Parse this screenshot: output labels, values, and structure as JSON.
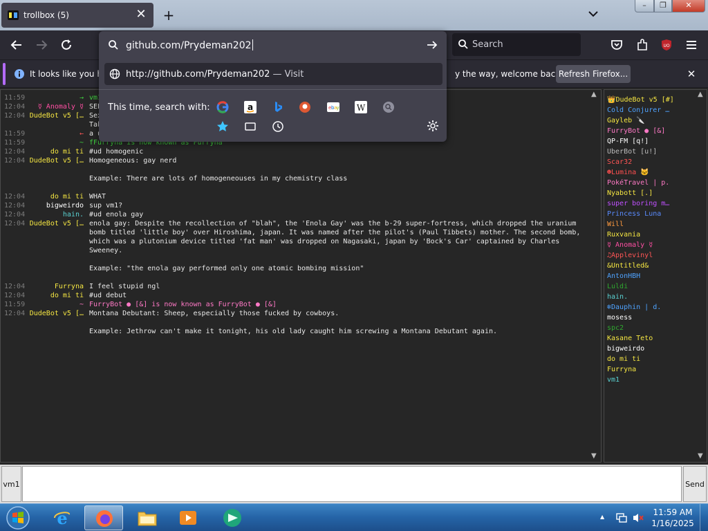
{
  "window": {
    "tab_title": "trollbox (5)",
    "close_tab_symbol": "✕",
    "new_tab_symbol": "+"
  },
  "url_bar": {
    "typed": "github.com/Prydeman202",
    "suggestion_url": "http://github.com/Prydeman202",
    "suggestion_sep": " — ",
    "suggestion_action": "Visit",
    "search_with_label": "This time, search with:",
    "engines": [
      "google-icon",
      "amazon-icon",
      "bing-icon",
      "duckduckgo-icon",
      "ebay-icon",
      "wikipedia-icon",
      "search-engine-icon",
      "bookmarks-icon",
      "tabs-icon",
      "history-icon"
    ]
  },
  "nav": {
    "search_placeholder": "Search"
  },
  "notification": {
    "text_left": "It looks like you ha",
    "text_right": "y the way, welcome back!",
    "refresh_label": "Refresh Firefox..."
  },
  "chat": {
    "messages": [
      {
        "ts": "11:59",
        "nick": "→",
        "nick_color": "#3fd23f",
        "text": "vm1 has entered teh trollbox",
        "text_color": "#3fd23f"
      },
      {
        "ts": "12:04",
        "nick": "☿ Anomaly ☿",
        "nick_color": "#ff4fa3",
        "text": "SEEEEEEX",
        "text_color": "#e8e8e8"
      },
      {
        "ts": "12:04",
        "nick": "DudeBot v5 […",
        "nick_color": "#f5e642",
        "text": "Sex: [definition]",
        "text_color": "#e8e8e8"
      },
      {
        "ts": "",
        "nick": "",
        "nick_color": "#e8e8e8",
        "text": "Taken from Urban Dictionary",
        "text_color": "#e8e8e8"
      },
      {
        "ts": "11:59",
        "nick": "←",
        "nick_color": "#ff5555",
        "text": "a user left",
        "text_color": "#e8e8e8"
      },
      {
        "ts": "11:59",
        "nick": "~",
        "nick_color": "#3fd23f",
        "text": "fFurryna is now known as Furryna",
        "text_color": "#3fd23f"
      },
      {
        "ts": "12:04",
        "nick": "do mi ti",
        "nick_color": "#f5e642",
        "text": "#ud homogenic",
        "text_color": "#e8e8e8"
      },
      {
        "ts": "12:04",
        "nick": "DudeBot v5 […",
        "nick_color": "#f5e642",
        "text": "Homogeneous: gay nerd",
        "text_color": "#e8e8e8"
      },
      {
        "ts": "",
        "nick": "",
        "nick_color": "#e8e8e8",
        "text": "",
        "text_color": "#e8e8e8"
      },
      {
        "ts": "",
        "nick": "",
        "nick_color": "#e8e8e8",
        "text": "Example: There are lots of homogeneouses in my chemistry class",
        "text_color": "#e8e8e8"
      },
      {
        "ts": "",
        "nick": "",
        "nick_color": "#e8e8e8",
        "text": "",
        "text_color": "#e8e8e8"
      },
      {
        "ts": "12:04",
        "nick": "do mi ti",
        "nick_color": "#f5e642",
        "text": "WHAT",
        "text_color": "#e8e8e8"
      },
      {
        "ts": "12:04",
        "nick": "bigweirdo",
        "nick_color": "#ffffff",
        "text": "sup vm1?",
        "text_color": "#e8e8e8"
      },
      {
        "ts": "12:04",
        "nick": "hain.",
        "nick_color": "#5ad2d2",
        "text": "#ud enola gay",
        "text_color": "#e8e8e8"
      },
      {
        "ts": "12:04",
        "nick": "DudeBot v5 […",
        "nick_color": "#f5e642",
        "text": "enola gay: Despite the recollection of \"blah\", the 'Enola Gay' was the b-29 super-fortress, which dropped the uranium bomb titled 'little boy' over Hiroshima, japan. It was named after the pilot's (Paul Tibbets) mother. The second bomb, which was a plutonium device titled 'fat man' was dropped on Nagasaki, japan by 'Bock's Car' captained by Charles Sweeney.",
        "text_color": "#e8e8e8"
      },
      {
        "ts": "",
        "nick": "",
        "nick_color": "#e8e8e8",
        "text": "",
        "text_color": "#e8e8e8"
      },
      {
        "ts": "",
        "nick": "",
        "nick_color": "#e8e8e8",
        "text": "Example: \"the enola gay performed only one atomic bombing mission\"",
        "text_color": "#e8e8e8"
      },
      {
        "ts": "",
        "nick": "",
        "nick_color": "#e8e8e8",
        "text": "",
        "text_color": "#e8e8e8"
      },
      {
        "ts": "12:04",
        "nick": "Furryna",
        "nick_color": "#f5e642",
        "text": "I feel stupid ngl",
        "text_color": "#e8e8e8"
      },
      {
        "ts": "12:04",
        "nick": "do mi ti",
        "nick_color": "#f5e642",
        "text": "#ud debut",
        "text_color": "#e8e8e8"
      },
      {
        "ts": "11:59",
        "nick": "~",
        "nick_color": "#ff79c6",
        "text": "FurryBot ● [&] is now known as FurryBot ● [&]",
        "text_color": "#ff79c6"
      },
      {
        "ts": "12:04",
        "nick": "DudeBot v5 […",
        "nick_color": "#f5e642",
        "text": "Montana Debutant: Sheep, especially those fucked by cowboys.",
        "text_color": "#e8e8e8"
      },
      {
        "ts": "",
        "nick": "",
        "nick_color": "#e8e8e8",
        "text": "",
        "text_color": "#e8e8e8"
      },
      {
        "ts": "",
        "nick": "",
        "nick_color": "#e8e8e8",
        "text": "Example: Jethrow can't make it tonight, his old lady caught him screwing a Montana Debutant again.",
        "text_color": "#e8e8e8"
      }
    ]
  },
  "users": [
    {
      "name": "👑DudeBot v5 [#]",
      "color": "#f5e642"
    },
    {
      "name": "Cold Conjurer …",
      "color": "#4fa3ff"
    },
    {
      "name": "Gayleb 🔪",
      "color": "#f5e642"
    },
    {
      "name": "FurryBot ● [&]",
      "color": "#ff79c6"
    },
    {
      "name": "QP-FM [q!]",
      "color": "#ffffff"
    },
    {
      "name": "UberBot [u!]",
      "color": "#bbbbbb"
    },
    {
      "name": "Scar32",
      "color": "#ff5555"
    },
    {
      "name": "☻Lumina 🐱",
      "color": "#ff4f4f"
    },
    {
      "name": "PokéTravel | p.",
      "color": "#ff79c6"
    },
    {
      "name": "Nyabott [.]",
      "color": "#f5e642"
    },
    {
      "name": "super boring m…",
      "color": "#c050ff"
    },
    {
      "name": "Princess Luna",
      "color": "#5a8cff"
    },
    {
      "name": "Will",
      "color": "#ff9b3f"
    },
    {
      "name": "Ruxvania",
      "color": "#f5e642"
    },
    {
      "name": "☿ Anomaly ☿",
      "color": "#ff4fa3"
    },
    {
      "name": "♫Applevinyl",
      "color": "#ff5555"
    },
    {
      "name": "&Untitled&",
      "color": "#f5e642"
    },
    {
      "name": "AntonHBH",
      "color": "#4fa3ff"
    },
    {
      "name": "Luldi",
      "color": "#2fa82f"
    },
    {
      "name": "hain.",
      "color": "#5ad2d2"
    },
    {
      "name": "❄Dauphin | d.",
      "color": "#4fa3ff"
    },
    {
      "name": "mosess",
      "color": "#ffffff"
    },
    {
      "name": "spc2",
      "color": "#2fa82f"
    },
    {
      "name": "Kasane Teto",
      "color": "#f5e642"
    },
    {
      "name": "bigweirdo",
      "color": "#ffffff"
    },
    {
      "name": "do mi ti",
      "color": "#f5e642"
    },
    {
      "name": "Furryna",
      "color": "#f5e642"
    },
    {
      "name": "vm1",
      "color": "#5ad2d2"
    }
  ],
  "input": {
    "nick_label": "vm1",
    "send_label": "Send"
  },
  "taskbar": {
    "time": "11:59 AM",
    "date": "1/16/2025"
  }
}
